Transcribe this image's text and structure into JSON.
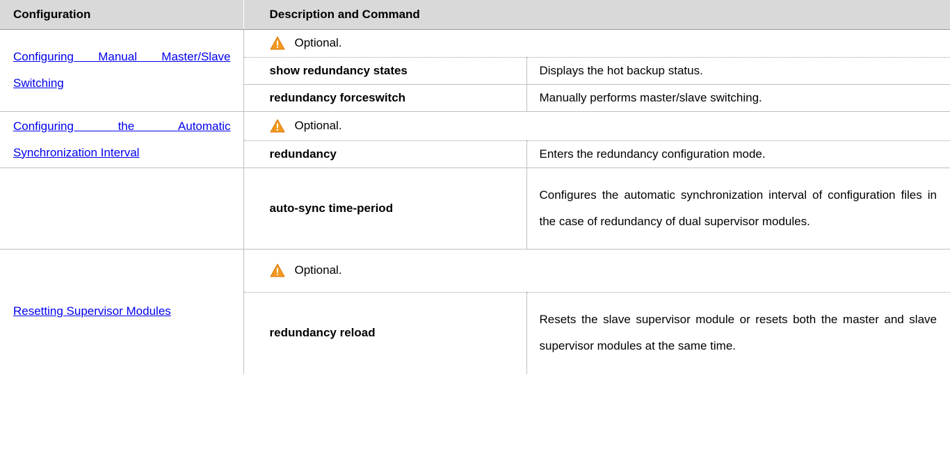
{
  "table": {
    "headers": [
      "Configuration",
      "Description and Command"
    ],
    "note_icon": "warning-icon",
    "colors": {
      "header_bg": "#d9d9d9",
      "link": "#0000ee",
      "warning": "#f29a1f"
    },
    "sections": [
      {
        "configuration": "Configuring Manual Master/Slave Switching",
        "note": "Optional.",
        "commands": [
          {
            "command": "show redundancy states",
            "description": "Displays the hot backup status."
          },
          {
            "command": "redundancy forceswitch",
            "description": "Manually performs master/slave switching."
          }
        ]
      },
      {
        "configuration": "Configuring the Automatic Synchronization Interval",
        "note": "Optional.",
        "commands": [
          {
            "command": "redundancy",
            "description": "Enters the redundancy configuration mode."
          },
          {
            "command": "auto-sync time-period",
            "description": "Configures the automatic synchronization interval of configuration files in the case of redundancy of dual supervisor modules."
          }
        ]
      },
      {
        "configuration": "Resetting Supervisor Modules",
        "note": "Optional.",
        "commands": [
          {
            "command": "redundancy reload",
            "description": "Resets the slave supervisor module or resets both the master and slave supervisor modules at the same time."
          }
        ]
      }
    ]
  }
}
